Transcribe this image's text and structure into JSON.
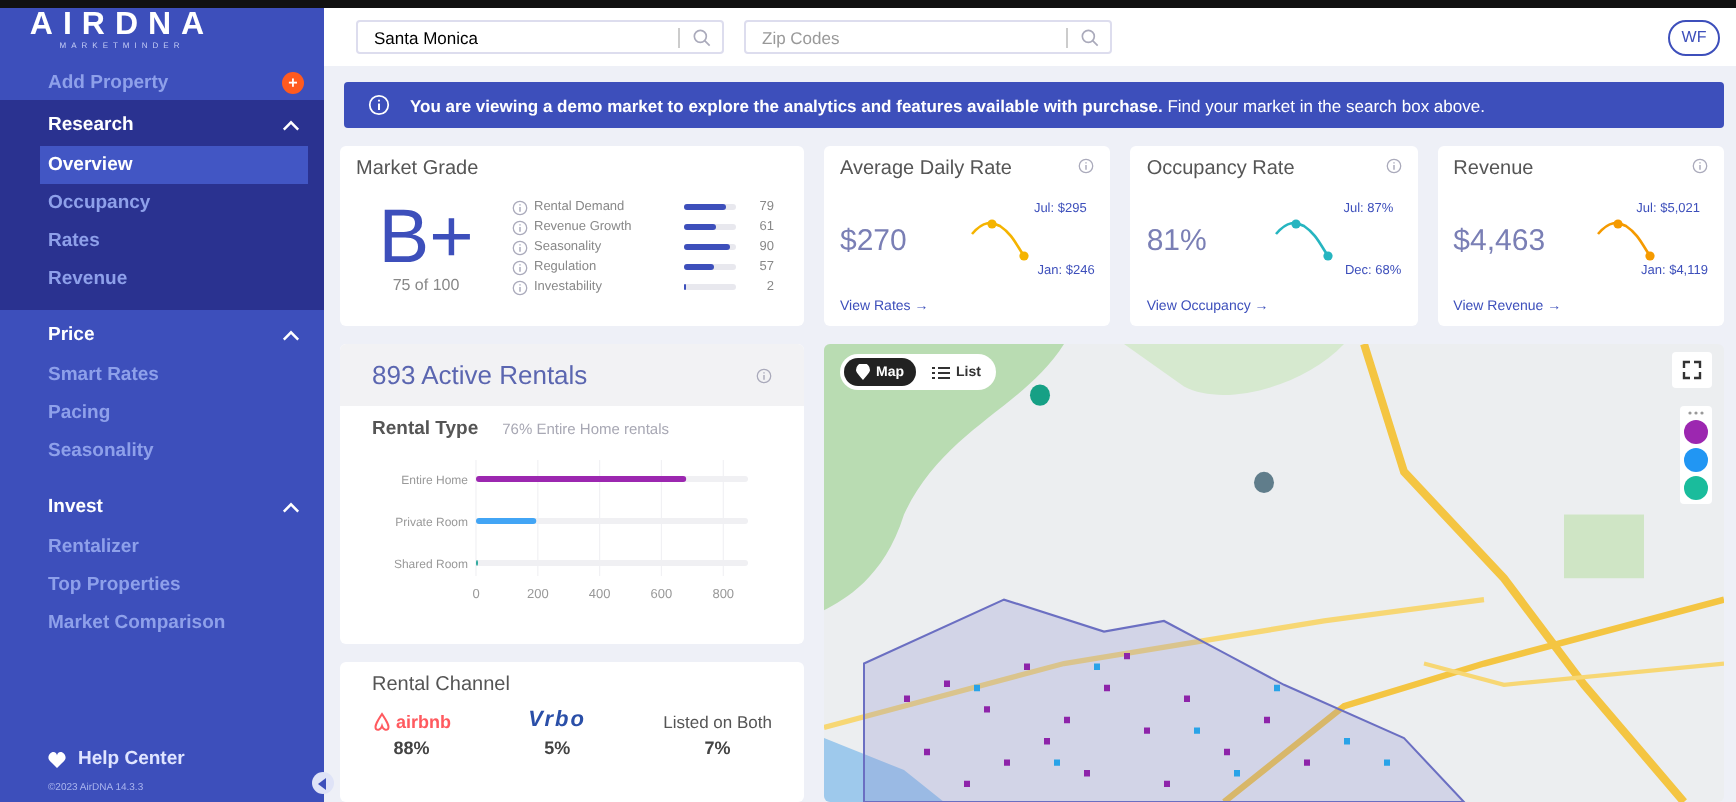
{
  "sidebar": {
    "logo": "AIRDNA",
    "logo_sub": "MARKETMINDER",
    "add_property": {
      "label": "Add Property",
      "badge": "+"
    },
    "sections": [
      {
        "label": "Research",
        "expanded": true,
        "items": [
          {
            "label": "Overview",
            "selected": true
          },
          {
            "label": "Occupancy",
            "selected": false
          },
          {
            "label": "Rates",
            "selected": false
          },
          {
            "label": "Revenue",
            "selected": false
          }
        ]
      },
      {
        "label": "Price",
        "expanded": true,
        "items": [
          {
            "label": "Smart Rates",
            "selected": false
          },
          {
            "label": "Pacing",
            "selected": false
          },
          {
            "label": "Seasonality",
            "selected": false
          }
        ]
      },
      {
        "label": "Invest",
        "expanded": true,
        "items": [
          {
            "label": "Rentalizer",
            "selected": false
          },
          {
            "label": "Top Properties",
            "selected": false
          },
          {
            "label": "Market Comparison",
            "selected": false
          }
        ]
      }
    ],
    "help": "Help Center",
    "version": "©2023 AirDNA 14.3.3"
  },
  "header": {
    "market_search": {
      "value": "Santa Monica"
    },
    "zip_search": {
      "placeholder": "Zip Codes"
    },
    "avatar": "WF"
  },
  "banner": {
    "text": "**You are viewing a demo market to explore the analytics and features available with purchase.** Find your market in the search box above."
  },
  "market_grade": {
    "title": "Market Grade",
    "grade": "B+",
    "score": "75 of 100",
    "factors": [
      {
        "label": "Rental Demand",
        "level": 0.79,
        "value": "79"
      },
      {
        "label": "Revenue Growth",
        "level": 0.61,
        "value": "61"
      },
      {
        "label": "Seasonality",
        "level": 0.9,
        "value": "90"
      },
      {
        "label": "Regulation",
        "level": 0.57,
        "value": "57"
      },
      {
        "label": "Investability",
        "level": 0.02,
        "value": "2"
      }
    ]
  },
  "metrics": [
    {
      "title": "Average Daily Rate",
      "value": "$270",
      "high": "Jul: $295",
      "low": "Jan: $246",
      "link": "View Rates →",
      "color": "#f5b400"
    },
    {
      "title": "Occupancy Rate",
      "value": "81%",
      "high": "Jul: 87%",
      "low": "Dec: 68%",
      "link": "View Occupancy →",
      "color": "#26b5c0"
    },
    {
      "title": "Revenue",
      "value": "$4,463",
      "high": "Jul: $5,021",
      "low": "Jan: $4,119",
      "link": "View Revenue →",
      "color": "#f59a00"
    }
  ],
  "active_rentals": {
    "title": "893 Active Rentals",
    "rental_type": {
      "title": "Rental Type",
      "note": "76% Entire Home rentals",
      "chart_data": {
        "type": "bar",
        "orientation": "horizontal",
        "grid": true,
        "series": [
          {
            "name": "Entire Home",
            "color": "#9c27b0",
            "values": [
              680
            ]
          },
          {
            "name": "Private Room",
            "color": "#42a5f5",
            "values": [
              195
            ]
          },
          {
            "name": "Shared Room",
            "color": "#26a69a",
            "values": [
              5
            ]
          }
        ],
        "xlim": [
          0,
          880
        ],
        "xticks": [
          0,
          200,
          400,
          600,
          800
        ]
      }
    }
  },
  "rental_channel": {
    "title": "Rental Channel",
    "channels": [
      {
        "kind": "airbnb",
        "name": "airbnb",
        "share": "88%"
      },
      {
        "kind": "vrbo",
        "name": "Vrbo",
        "share": "5%"
      },
      {
        "kind": "both",
        "name": "Listed on Both",
        "share": "7%"
      }
    ]
  },
  "map": {
    "kind": "picture",
    "views": [
      {
        "label": "Map",
        "selected": true
      },
      {
        "label": "List",
        "selected": false
      }
    ],
    "layers": [
      {
        "color": "#9c27b0"
      },
      {
        "color": "#2196f3"
      },
      {
        "color": "#1abc9c"
      }
    ]
  }
}
